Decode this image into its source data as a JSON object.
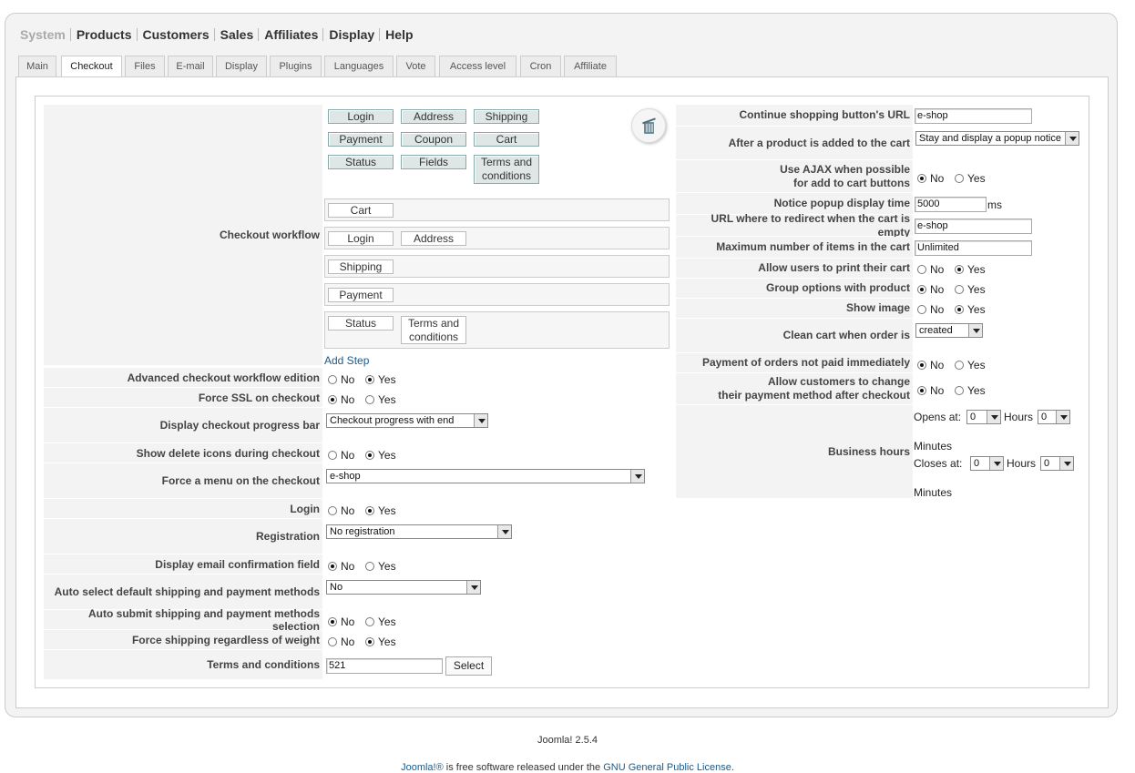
{
  "topnav": {
    "system": "System",
    "products": "Products",
    "customers": "Customers",
    "sales": "Sales",
    "affiliates": "Affiliates",
    "display": "Display",
    "help": "Help"
  },
  "tabs": [
    "Main",
    "Checkout",
    "Files",
    "E-mail",
    "Display",
    "Plugins",
    "Languages",
    "Vote",
    "Access level",
    "Cron",
    "Affiliate"
  ],
  "workflow": {
    "label": "Checkout workflow",
    "palette": {
      "login": "Login",
      "address": "Address",
      "shipping": "Shipping",
      "payment": "Payment",
      "coupon": "Coupon",
      "cart": "Cart",
      "status": "Status",
      "fields": "Fields",
      "terms_line1": "Terms and",
      "terms_line2": "conditions"
    },
    "steps": {
      "cart": "Cart",
      "login": "Login",
      "address": "Address",
      "shipping": "Shipping",
      "payment": "Payment",
      "status": "Status",
      "terms_line1": "Terms and",
      "terms_line2": "conditions"
    },
    "add_step": "Add Step"
  },
  "opt": {
    "no": "No",
    "yes": "Yes",
    "select": "Select",
    "ms": "ms",
    "hours": "Hours",
    "minutes": "Minutes",
    "opens_at": "Opens at:",
    "closes_at": "Closes at:"
  },
  "left": {
    "advanced": "Advanced checkout workflow edition",
    "force_ssl": "Force SSL on checkout",
    "progress": "Display checkout progress bar",
    "progress_value": "Checkout progress with end",
    "delete_icons": "Show delete icons during checkout",
    "force_menu": "Force a menu on the checkout",
    "force_menu_value": "e-shop",
    "login": "Login",
    "registration": "Registration",
    "registration_value": "No registration",
    "email_confirm": "Display email confirmation field",
    "auto_select": "Auto select default shipping and payment methods",
    "auto_select_value": "No",
    "auto_submit": "Auto submit shipping and payment methods selection",
    "force_shipping": "Force shipping regardless of weight",
    "terms": "Terms and conditions",
    "terms_value": "521"
  },
  "right": {
    "continue_url": "Continue shopping button's URL",
    "continue_url_value": "e-shop",
    "after_add": "After a product is added to the cart",
    "after_add_value": "Stay and display a popup notice",
    "ajax_l1": "Use AJAX when possible",
    "ajax_l2": "for add to cart buttons",
    "notice_time": "Notice popup display time",
    "notice_time_value": "5000",
    "redirect_url": "URL where to redirect when the cart is empty",
    "redirect_url_value": "e-shop",
    "max_items": "Maximum number of items in the cart",
    "max_items_value": "Unlimited",
    "print_cart": "Allow users to print their cart",
    "group_options": "Group options with product",
    "show_image": "Show image",
    "clean_cart": "Clean cart when order is",
    "clean_cart_value": "created",
    "not_paid": "Payment of orders not paid immediately",
    "change_pm_l1": "Allow customers to change",
    "change_pm_l2": "their payment method after checkout",
    "business_hours": "Business hours",
    "open_h": "0",
    "open_m": "0",
    "close_h": "0",
    "close_m": "0"
  },
  "footer": {
    "version": "Joomla! 2.5.4",
    "joomla": "Joomla!®",
    "free_text": " is free software released under the ",
    "license": "GNU General Public License",
    "period": "."
  }
}
